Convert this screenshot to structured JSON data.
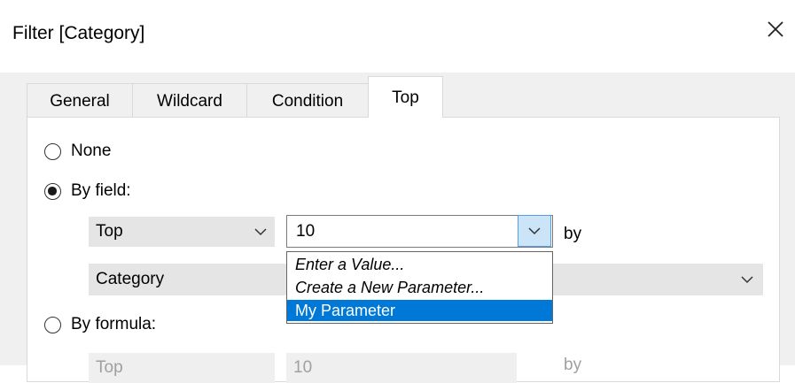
{
  "window": {
    "title": "Filter [Category]",
    "close_icon": "close-icon"
  },
  "tabs": [
    {
      "label": "General",
      "active": false
    },
    {
      "label": "Wildcard",
      "active": false
    },
    {
      "label": "Condition",
      "active": false
    },
    {
      "label": "Top",
      "active": true
    }
  ],
  "options": {
    "none_label": "None",
    "by_field_label": "By field:",
    "by_formula_label": "By formula:",
    "selected": "By field:"
  },
  "by_field": {
    "top_bottom_value": "Top",
    "count_value": "10",
    "by_label": "by",
    "field_value": "Category"
  },
  "dropdown": {
    "items": [
      "Enter a Value...",
      "Create a New Parameter...",
      "My Parameter"
    ],
    "selected_item": "My Parameter"
  },
  "by_formula": {
    "top_bottom_value": "Top",
    "count_value": "10",
    "by_label": "by"
  },
  "colors": {
    "accent": "#0078d7",
    "dropdown_button": "#cce4f7",
    "combo_background": "#e5e5e5"
  }
}
